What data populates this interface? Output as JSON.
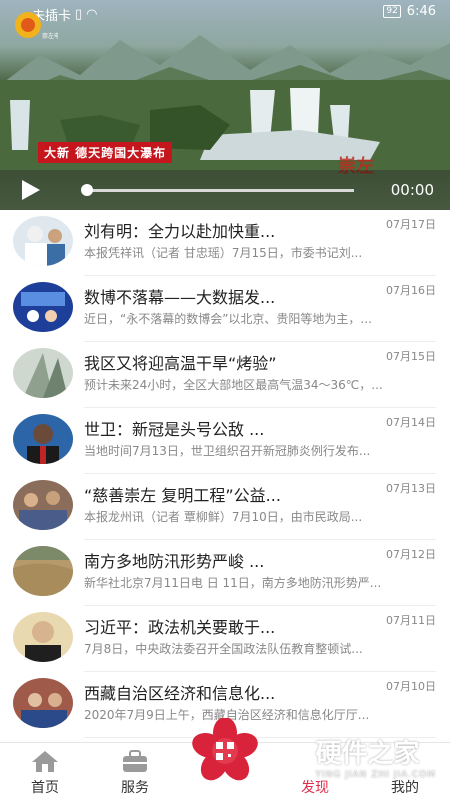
{
  "status_bar": {
    "carrier": "未插卡",
    "battery": "92",
    "time": "6:46"
  },
  "video": {
    "logo_text": "崇左电视台",
    "caption": "大新 德天跨国大瀑布",
    "overlay_text": "崇左",
    "time": "00:00",
    "progress_fraction": 0.0
  },
  "news": [
    {
      "title": "刘有明：全力以赴加快重...",
      "date": "07月17日",
      "summary": "本报凭祥讯（记者 甘忠瑶）7月15日，市委书记刘..."
    },
    {
      "title": "数博不落幕——大数据发...",
      "date": "07月16日",
      "summary": "近日，“永不落幕的数博会”以北京、贵阳等地为主，..."
    },
    {
      "title": "我区又将迎高温干旱“烤验”",
      "date": "07月15日",
      "summary": "预计未来24小时，全区大部地区最高气温34～36℃，..."
    },
    {
      "title": "世卫：新冠是头号公敌 ...",
      "date": "07月14日",
      "summary": "当地时间7月13日，世卫组织召开新冠肺炎例行发布..."
    },
    {
      "title": "“慈善崇左 复明工程”公益...",
      "date": "07月13日",
      "summary": "本报龙州讯（记者 覃柳鲜）7月10日，由市民政局..."
    },
    {
      "title": "南方多地防汛形势严峻 ...",
      "date": "07月12日",
      "summary": "新华社北京7月11日电 日 11日，南方多地防汛形势严..."
    },
    {
      "title": "习近平：政法机关要敢于...",
      "date": "07月11日",
      "summary": "7月8日，中央政法委召开全国政法队伍教育整顿试..."
    },
    {
      "title": "西藏自治区经济和信息化...",
      "date": "07月10日",
      "summary": "2020年7月9日上午，西藏自治区经济和信息化厅厅..."
    }
  ],
  "tabs": [
    {
      "label": "首页"
    },
    {
      "label": "服务"
    },
    {
      "label": "发现"
    },
    {
      "label": "我的"
    }
  ],
  "watermark": {
    "cn": "硬件之家",
    "en": "YING JIAN ZHI JIA.COM"
  },
  "colors": {
    "accent": "#e02e4c",
    "caption_bg": "#c4161c"
  }
}
